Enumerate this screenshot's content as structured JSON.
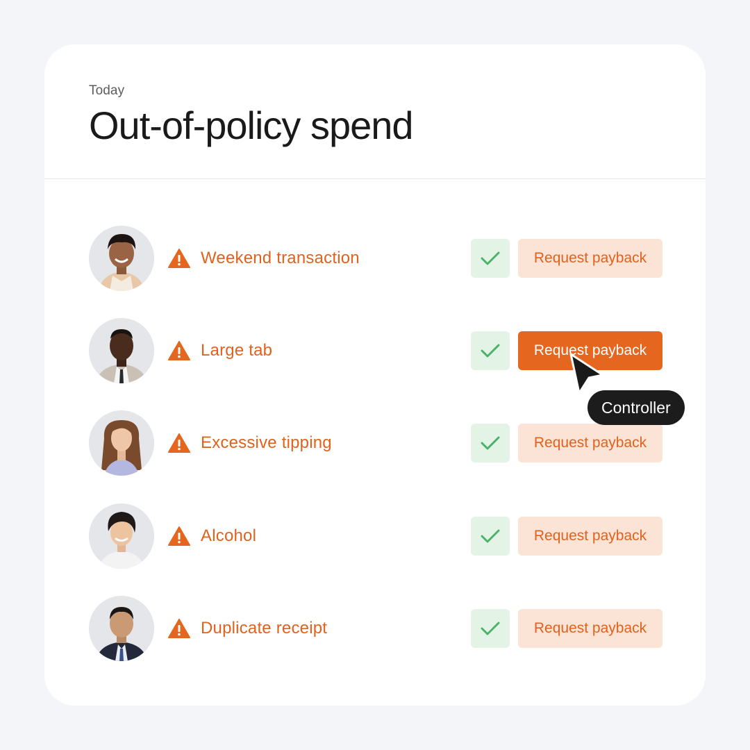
{
  "card": {
    "eyebrow": "Today",
    "title": "Out-of-policy spend"
  },
  "colors": {
    "accent": "#e5661f",
    "accent_soft": "#fbe3d6",
    "approve_bg": "#e3f4e7",
    "approve_check": "#4cb26a"
  },
  "rows": [
    {
      "label": "Weekend transaction",
      "action": "Request payback",
      "approve_icon": "check-icon",
      "warning_icon": "warning-icon"
    },
    {
      "label": "Large tab",
      "action": "Request payback",
      "approve_icon": "check-icon",
      "warning_icon": "warning-icon"
    },
    {
      "label": "Excessive tipping",
      "action": "Request payback",
      "approve_icon": "check-icon",
      "warning_icon": "warning-icon"
    },
    {
      "label": "Alcohol",
      "action": "Request payback",
      "approve_icon": "check-icon",
      "warning_icon": "warning-icon"
    },
    {
      "label": "Duplicate receipt",
      "action": "Request payback",
      "approve_icon": "check-icon",
      "warning_icon": "warning-icon"
    }
  ],
  "cursor": {
    "tooltip": "Controller"
  }
}
